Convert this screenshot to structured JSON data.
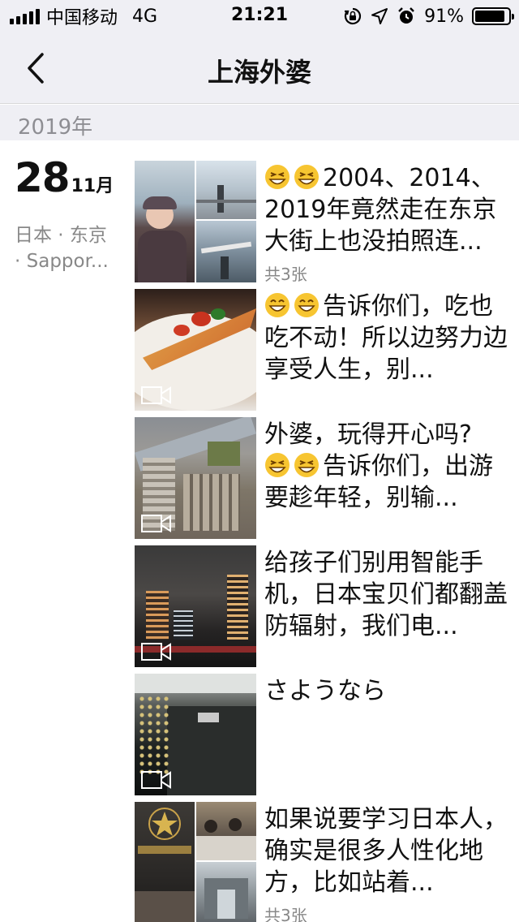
{
  "status_bar": {
    "carrier": "中国移动",
    "network": "4G",
    "time": "21:21",
    "battery_percent": "91%",
    "battery_level": 0.91,
    "icons": [
      "signal-bars-icon",
      "rotation-lock-icon",
      "location-arrow-icon",
      "alarm-icon",
      "battery-icon"
    ]
  },
  "nav": {
    "back_icon": "chevron-left-icon",
    "title": "上海外婆"
  },
  "year_header": "2019年",
  "date": {
    "day": "28",
    "month": "11月",
    "location": [
      "日本 · 东京",
      "· Sappor..."
    ]
  },
  "posts": [
    {
      "text": "2004、2014、2019年竟然走在东京大街上也没拍照连...",
      "emoji": [
        "grin-squint-emoji",
        "grin-squint-emoji"
      ],
      "count": "共3张",
      "media": "photo-grid"
    },
    {
      "text": "告诉你们，吃也吃不动！所以边努力边享受人生，别...",
      "emoji": [
        "grin-emoji",
        "grin-emoji"
      ],
      "media": "video"
    },
    {
      "text_before": "外婆，玩得开心吗?",
      "text": "告诉你们，出游要趁年轻，别输...",
      "emoji": [
        "grin-squint-emoji",
        "grin-squint-emoji"
      ],
      "media": "video"
    },
    {
      "text": "给孩子们别用智能手机，日本宝贝们都翻盖防辐射，我们电...",
      "media": "video"
    },
    {
      "text": "さようなら",
      "media": "video"
    },
    {
      "text": "如果说要学习日本人，确实是很多人性化地方，比如站着...",
      "count": "共3张",
      "media": "photo-grid"
    }
  ],
  "colors": {
    "bar_background": "#efeff4",
    "muted_text": "#8e8e93",
    "emoji_yellow": "#f7c531"
  }
}
